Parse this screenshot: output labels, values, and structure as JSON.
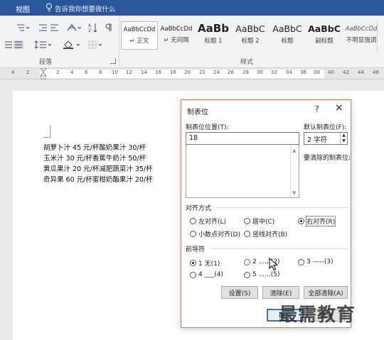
{
  "ribbon_top": {
    "view_tab": "视图",
    "tell_me": "告诉我你想要做什么"
  },
  "ribbon": {
    "paragraph_group_label": "段落",
    "styles_group_label": "样式",
    "styles": [
      {
        "sample": "AaBbCcDd",
        "name": "正文",
        "selected": true
      },
      {
        "sample": "AaBbCcDd",
        "name": "无间隔",
        "selected": false
      },
      {
        "sample": "AaBb",
        "name": "标题 1",
        "selected": false
      },
      {
        "sample": "AaBbC",
        "name": "标题 2",
        "selected": false
      },
      {
        "sample": "AaBbC",
        "name": "标题",
        "selected": false
      },
      {
        "sample": "AaBbC",
        "name": "副标题",
        "selected": false
      },
      {
        "sample": "AaBbCcDd",
        "name": "不明显强调",
        "selected": false
      }
    ]
  },
  "ruler": {
    "numbers": [
      "4",
      "2",
      "2",
      "4",
      "6",
      "8",
      "10",
      "12",
      "14",
      "16",
      "18",
      "20",
      "22",
      "24",
      "26",
      "28",
      "30",
      "32",
      "34",
      "36",
      "38",
      "40",
      "42",
      "44",
      "46"
    ]
  },
  "document": {
    "lines": [
      "胡萝卜汁 45 元/杯酸奶果汁 30/杯",
      "玉米汁 30 元/杯香蕉牛奶汁 50/杯",
      "黄瓜果汁 20 元/杯减肥蔬菜汁 35/杯",
      "奇异果 60 元/杯蜜柑奶酯果汁 20/杯"
    ]
  },
  "dialog": {
    "title": "制表位",
    "help": "?",
    "close": "×",
    "tab_position_label": "制表位位置(T):",
    "tab_position_value": "18",
    "default_tab_label": "默认制表位(F):",
    "default_tab_value": "2 字符",
    "clear_label": "要清除的制表位:",
    "alignment_label": "对齐方式",
    "alignment_options": [
      {
        "label": "左对齐(L)",
        "selected": false
      },
      {
        "label": "居中(C)",
        "selected": false
      },
      {
        "label": "右对齐(R)",
        "selected": true
      },
      {
        "label": "小数点对齐(D)",
        "selected": false
      },
      {
        "label": "竖线对齐(B)",
        "selected": false
      }
    ],
    "leader_label": "前导符",
    "leader_options": [
      {
        "label": "1 无(1)",
        "selected": true
      },
      {
        "label": "2 ......(2)",
        "selected": false
      },
      {
        "label": "3 -----(3)",
        "selected": false
      },
      {
        "label": "4 ___(4)",
        "selected": false
      },
      {
        "label": "5 ......(5)",
        "selected": false
      }
    ],
    "buttons": {
      "set": "设置(S)",
      "clear": "清除(E)",
      "clear_all": "全部清除(A)",
      "ok": "确定",
      "cancel": "取消"
    }
  },
  "watermark": "最需教育",
  "colors": {
    "ribbon_blue": "#2b579a",
    "dialog_border": "#d27f5c",
    "focus_blue": "#3b77c6"
  }
}
